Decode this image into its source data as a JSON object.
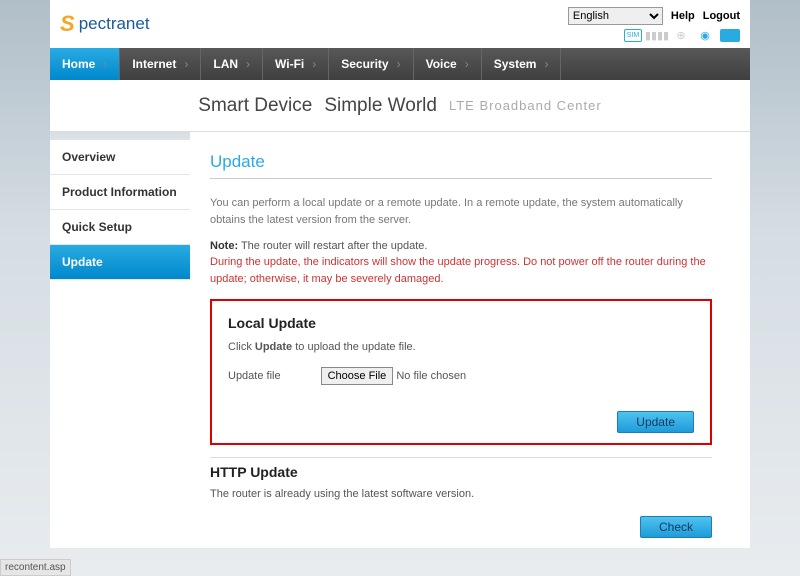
{
  "header": {
    "brand": "pectranet",
    "language": "English",
    "help": "Help",
    "logout": "Logout"
  },
  "nav": {
    "items": [
      "Home",
      "Internet",
      "LAN",
      "Wi-Fi",
      "Security",
      "Voice",
      "System"
    ],
    "active_index": 0
  },
  "tagline": {
    "part1": "Smart Device",
    "part2": "Simple World",
    "part3": "LTE  Broadband  Center"
  },
  "sidebar": {
    "items": [
      "Overview",
      "Product Information",
      "Quick Setup",
      "Update"
    ],
    "active_index": 3
  },
  "main": {
    "title": "Update",
    "intro": "You can perform a local update or a remote update. In a remote update, the system automatically obtains the latest version from the server.",
    "note_label": "Note:",
    "note_text": " The router will restart after the update.",
    "warning": "During the update, the indicators will show the update progress. Do not power off the router during the update; otherwise, it may be severely damaged.",
    "local": {
      "title": "Local Update",
      "desc_pre": "Click ",
      "desc_bold": "Update",
      "desc_post": " to upload the update file.",
      "file_label": "Update file",
      "choose_btn": "Choose File",
      "file_status": "No file chosen",
      "update_btn": "Update"
    },
    "http": {
      "title": "HTTP Update",
      "status": "The router is already using the latest software version.",
      "check_btn": "Check"
    }
  },
  "status_bar": "recontent.asp"
}
